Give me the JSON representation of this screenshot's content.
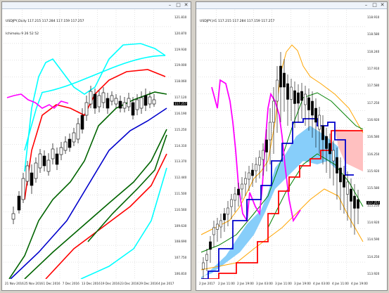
{
  "left_window": {
    "header_line1": "USDJPY,Daily 117.215 117.284 117.159 117.257",
    "header_line2": "Ichimoku 9 26 52 52",
    "yticks": [
      "121.810",
      "120.870",
      "119.930",
      "119.000",
      "118.060",
      "117.120",
      "116.190",
      "115.250",
      "114.310",
      "113.370",
      "112.440",
      "111.500",
      "110.560",
      "109.630",
      "108.690",
      "107.750",
      "106.810"
    ],
    "xticks": [
      "21 Nov 2016",
      "25 Nov 2016",
      "1 Dec 2016",
      "7 Dec 2016",
      "13 Dec 2016",
      "19 Dec 2016",
      "23 Dec 2016",
      "29 Dec 2016",
      "4 Jan 2017"
    ],
    "price_tag": "117.257",
    "colors": {
      "tenkan": "#0000cc",
      "kijun": "#006400",
      "chikou": "#ff00ff",
      "band_red": "#ff0000",
      "band_cyan": "#00ffff",
      "band_green": "#006400"
    }
  },
  "right_window": {
    "header_line1": "USDJPY,H1 117.215 117.284 117.159 117.257",
    "yticks": [
      "118.910",
      "118.580",
      "118.240",
      "117.910",
      "117.580",
      "117.250",
      "116.920",
      "116.580",
      "116.250",
      "115.920",
      "115.580",
      "115.250",
      "114.920",
      "114.590",
      "114.250",
      "113.920"
    ],
    "xticks": [
      "2 Jan 2017",
      "2 Jan 11:00",
      "2 Jan 19:00",
      "3 Jan 03:00",
      "3 Jan 11:00",
      "3 Jan 19:00",
      "4 Jan 03:00",
      "4 Jan 11:00",
      "4 Jan 19:00"
    ],
    "price_tag": "117.257",
    "colors": {
      "kumo_bull": "#87cefa",
      "kumo_bear": "#ffc0c0",
      "tenkan": "#0000cc",
      "kijun": "#ff0000",
      "chikou": "#ff00ff",
      "bb_outer": "#ffa500",
      "bb_mid": "#008000"
    }
  }
}
